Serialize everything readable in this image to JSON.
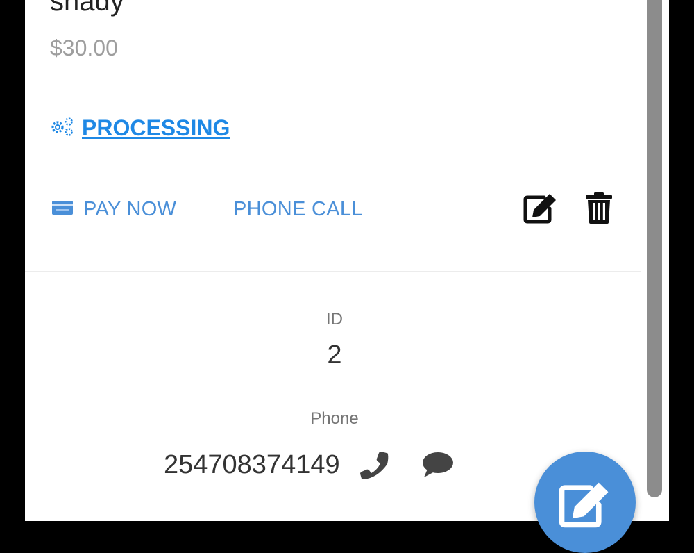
{
  "item": {
    "name": "shady",
    "price": "$30.00"
  },
  "status": {
    "label": "PROCESSING",
    "icon": "cogs-icon"
  },
  "actions": {
    "pay_label": "PAY NOW",
    "call_label": "PHONE CALL",
    "pay_icon": "credit-card-icon",
    "edit_icon": "edit-icon",
    "delete_icon": "trash-icon"
  },
  "details": {
    "id_label": "ID",
    "id_value": "2",
    "phone_label": "Phone",
    "phone_value": "254708374149",
    "phone_icon": "phone-icon",
    "message_icon": "comment-icon"
  },
  "fab": {
    "icon": "edit-icon"
  },
  "colors": {
    "accent": "#4a8fd8",
    "link": "#1e88e5",
    "muted": "#9e9e9e",
    "text": "#333333",
    "background": "#000000"
  }
}
